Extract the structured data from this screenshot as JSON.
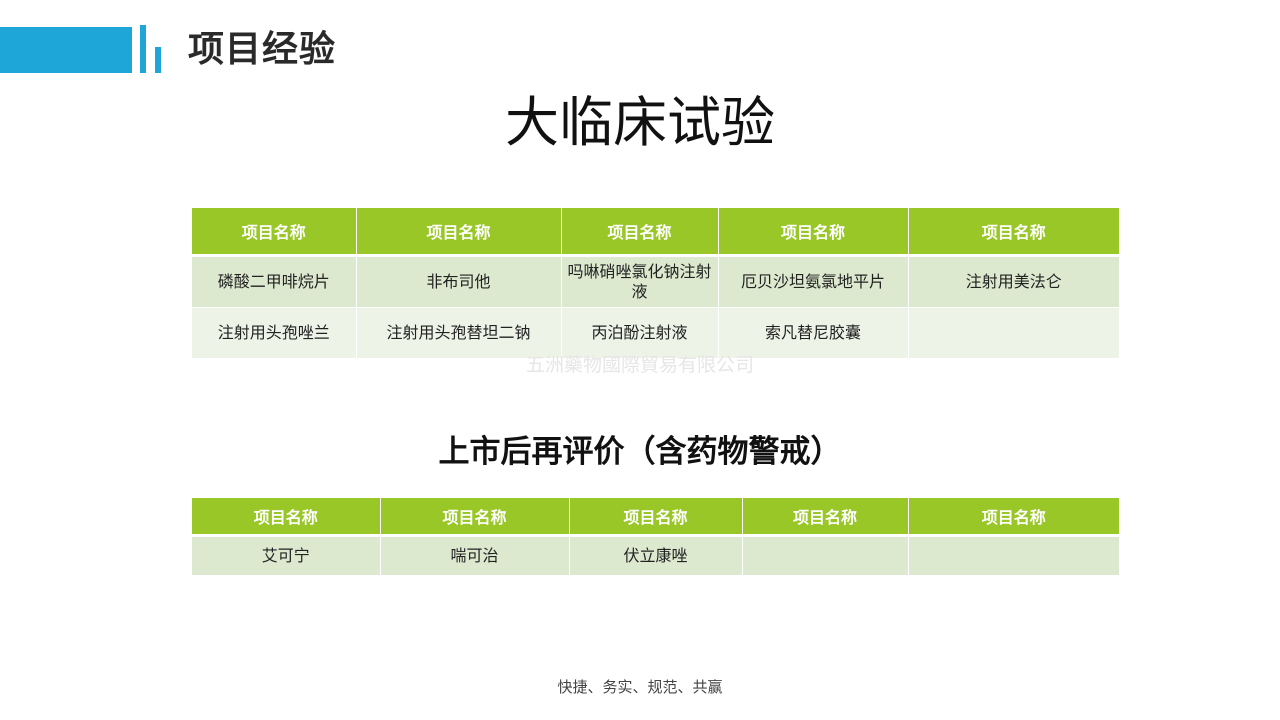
{
  "header": {
    "section_title": "项目经验",
    "accent_color": "#1ea6d8"
  },
  "main_title": "大临床试验",
  "table1": {
    "header_color": "#99c727",
    "columns": [
      "项目名称",
      "项目名称",
      "项目名称",
      "项目名称",
      "项目名称"
    ],
    "rows": [
      [
        "磷酸二甲啡烷片",
        "非布司他",
        "吗啉硝唑氯化钠注射液",
        "厄贝沙坦氨氯地平片",
        "注射用美法仑"
      ],
      [
        "注射用头孢唑兰",
        "注射用头孢替坦二钠",
        "丙泊酚注射液",
        "索凡替尼胶囊",
        ""
      ]
    ]
  },
  "watermark": "五洲藥物國際貿易有限公司",
  "sub_title": "上市后再评价（含药物警戒）",
  "table2": {
    "columns": [
      "项目名称",
      "项目名称",
      "项目名称",
      "项目名称",
      "项目名称"
    ],
    "rows": [
      [
        "艾可宁",
        "喘可治",
        "伏立康唑",
        "",
        ""
      ]
    ]
  },
  "footer": "快捷、务实、规范、共赢"
}
